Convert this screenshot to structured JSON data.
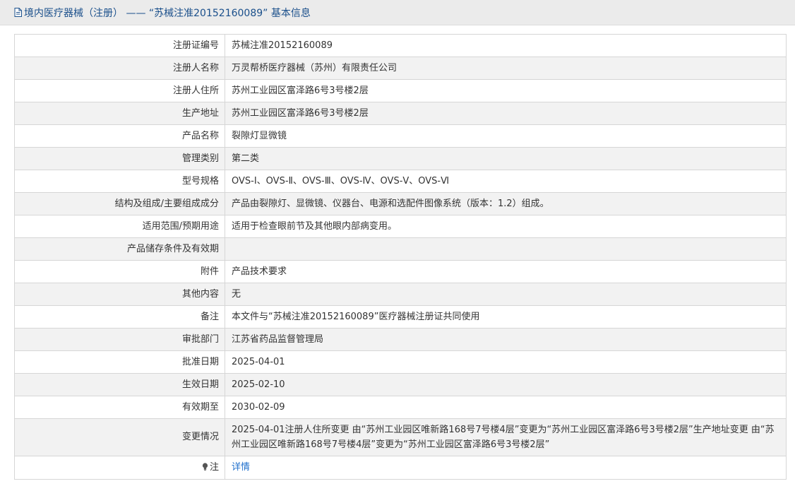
{
  "header": {
    "title": "境内医疗器械（注册） —— “苏械注准20152160089”  基本信息",
    "icon": "document-icon"
  },
  "rows": [
    {
      "label": "注册证编号",
      "value": "苏械注准20152160089"
    },
    {
      "label": "注册人名称",
      "value": "万灵帮桥医疗器械（苏州）有限责任公司"
    },
    {
      "label": "注册人住所",
      "value": "苏州工业园区富泽路6号3号楼2层"
    },
    {
      "label": "生产地址",
      "value": "苏州工业园区富泽路6号3号楼2层"
    },
    {
      "label": "产品名称",
      "value": "裂隙灯显微镜"
    },
    {
      "label": "管理类别",
      "value": "第二类"
    },
    {
      "label": "型号规格",
      "value": "OVS-Ⅰ、OVS-Ⅱ、OVS-Ⅲ、OVS-Ⅳ、OVS-Ⅴ、OVS-Ⅵ"
    },
    {
      "label": "结构及组成/主要组成成分",
      "value": "产品由裂隙灯、显微镜、仪器台、电源和选配件图像系统（版本：1.2）组成。"
    },
    {
      "label": "适用范围/预期用途",
      "value": "适用于检查眼前节及其他眼内部病变用。"
    },
    {
      "label": "产品储存条件及有效期",
      "value": ""
    },
    {
      "label": "附件",
      "value": "产品技术要求"
    },
    {
      "label": "其他内容",
      "value": "无"
    },
    {
      "label": "备注",
      "value": "本文件与“苏械注准20152160089”医疗器械注册证共同使用"
    },
    {
      "label": "审批部门",
      "value": "江苏省药品监督管理局"
    },
    {
      "label": "批准日期",
      "value": "2025-04-01"
    },
    {
      "label": "生效日期",
      "value": "2025-02-10"
    },
    {
      "label": "有效期至",
      "value": "2030-02-09"
    },
    {
      "label": "变更情况",
      "value": "2025-04-01注册人住所变更 由“苏州工业园区唯新路168号7号楼4层”变更为“苏州工业园区富泽路6号3号楼2层”生产地址变更 由“苏州工业园区唯新路168号7号楼4层”变更为“苏州工业园区富泽路6号3号楼2层”"
    },
    {
      "label": "注",
      "value": "详情",
      "label_icon": "lightbulb-icon"
    }
  ],
  "colors": {
    "title": "#1a4f8b",
    "link": "#1f6fcc",
    "border": "#d6d6d6",
    "row_alt": "#f2f2f2",
    "header_bg": "#ebebeb"
  }
}
